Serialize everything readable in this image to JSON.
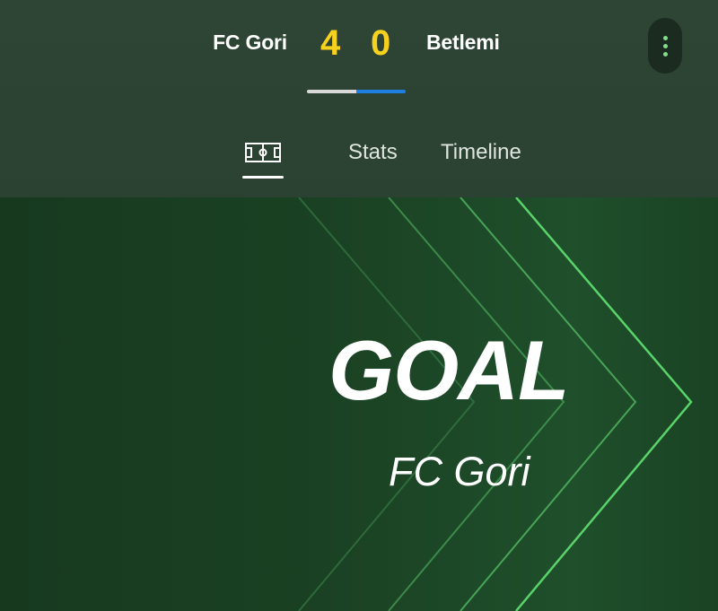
{
  "match": {
    "home_team": "FC Gori",
    "away_team": "Betlemi",
    "home_score": "4",
    "away_score": "0",
    "possession_home_fraction": 0.5,
    "colors": {
      "score": "#f6d21f",
      "possession_home": "#d9d9d9",
      "possession_away": "#1f7fe0"
    }
  },
  "menu": {
    "icon": "more-vert-icon",
    "dot_color": "#7fe08a"
  },
  "tabs": [
    {
      "icon": "pitch-icon",
      "label": "",
      "selected": true
    },
    {
      "label": "Stats",
      "selected": false
    },
    {
      "label": "Timeline",
      "selected": false
    }
  ],
  "banner": {
    "title": "GOAL",
    "team": "FC Gori",
    "accent": "#5ad46a"
  }
}
